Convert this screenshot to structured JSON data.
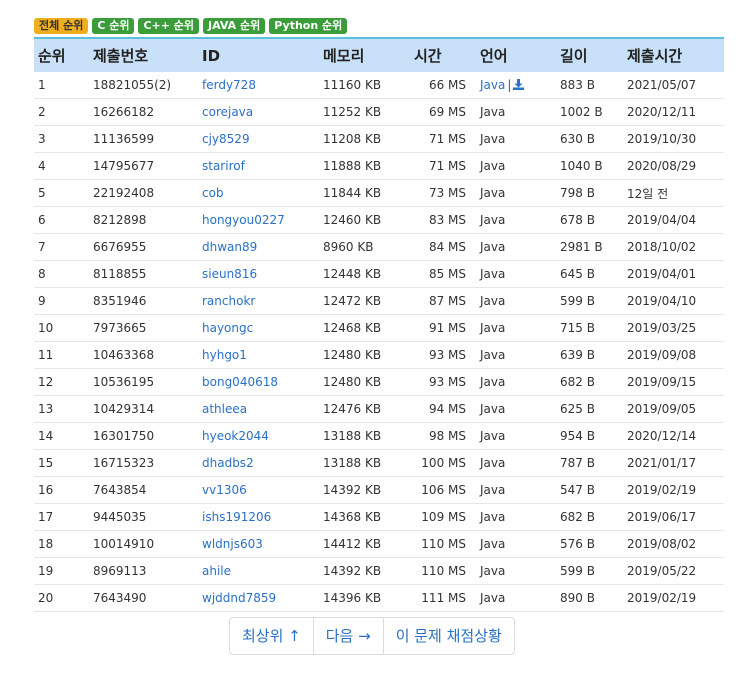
{
  "tabs": [
    {
      "label": "전체 순위",
      "active": true
    },
    {
      "label": "C 순위",
      "active": false
    },
    {
      "label": "C++ 순위",
      "active": false
    },
    {
      "label": "JAVA 순위",
      "active": false
    },
    {
      "label": "Python 순위",
      "active": false
    }
  ],
  "table": {
    "headers": [
      "순위",
      "제출번호",
      "ID",
      "메모리",
      "시간",
      "언어",
      "길이",
      "제출시간"
    ],
    "rows": [
      {
        "rank": "1",
        "submission": "18821055(2)",
        "id": "ferdy728",
        "memory": "11160 KB",
        "time": "66 MS",
        "lang": "Java",
        "length": "883 B",
        "submitted": "2021/05/07"
      },
      {
        "rank": "2",
        "submission": "16266182",
        "id": "corejava",
        "memory": "11252 KB",
        "time": "69 MS",
        "lang": "Java",
        "length": "1002 B",
        "submitted": "2020/12/11"
      },
      {
        "rank": "3",
        "submission": "11136599",
        "id": "cjy8529",
        "memory": "11208 KB",
        "time": "71 MS",
        "lang": "Java",
        "length": "630 B",
        "submitted": "2019/10/30"
      },
      {
        "rank": "4",
        "submission": "14795677",
        "id": "starirof",
        "memory": "11888 KB",
        "time": "71 MS",
        "lang": "Java",
        "length": "1040 B",
        "submitted": "2020/08/29"
      },
      {
        "rank": "5",
        "submission": "22192408",
        "id": "cob",
        "memory": "11844 KB",
        "time": "73 MS",
        "lang": "Java",
        "length": "798 B",
        "submitted": "12일 전"
      },
      {
        "rank": "6",
        "submission": "8212898",
        "id": "hongyou0227",
        "memory": "12460 KB",
        "time": "83 MS",
        "lang": "Java",
        "length": "678 B",
        "submitted": "2019/04/04"
      },
      {
        "rank": "7",
        "submission": "6676955",
        "id": "dhwan89",
        "memory": "8960 KB",
        "time": "84 MS",
        "lang": "Java",
        "length": "2981 B",
        "submitted": "2018/10/02"
      },
      {
        "rank": "8",
        "submission": "8118855",
        "id": "sieun816",
        "memory": "12448 KB",
        "time": "85 MS",
        "lang": "Java",
        "length": "645 B",
        "submitted": "2019/04/01"
      },
      {
        "rank": "9",
        "submission": "8351946",
        "id": "ranchokr",
        "memory": "12472 KB",
        "time": "87 MS",
        "lang": "Java",
        "length": "599 B",
        "submitted": "2019/04/10"
      },
      {
        "rank": "10",
        "submission": "7973665",
        "id": "hayongc",
        "memory": "12468 KB",
        "time": "91 MS",
        "lang": "Java",
        "length": "715 B",
        "submitted": "2019/03/25"
      },
      {
        "rank": "11",
        "submission": "10463368",
        "id": "hyhgo1",
        "memory": "12480 KB",
        "time": "93 MS",
        "lang": "Java",
        "length": "639 B",
        "submitted": "2019/09/08"
      },
      {
        "rank": "12",
        "submission": "10536195",
        "id": "bong040618",
        "memory": "12480 KB",
        "time": "93 MS",
        "lang": "Java",
        "length": "682 B",
        "submitted": "2019/09/15"
      },
      {
        "rank": "13",
        "submission": "10429314",
        "id": "athleea",
        "memory": "12476 KB",
        "time": "94 MS",
        "lang": "Java",
        "length": "625 B",
        "submitted": "2019/09/05"
      },
      {
        "rank": "14",
        "submission": "16301750",
        "id": "hyeok2044",
        "memory": "13188 KB",
        "time": "98 MS",
        "lang": "Java",
        "length": "954 B",
        "submitted": "2020/12/14"
      },
      {
        "rank": "15",
        "submission": "16715323",
        "id": "dhadbs2",
        "memory": "13188 KB",
        "time": "100 MS",
        "lang": "Java",
        "length": "787 B",
        "submitted": "2021/01/17"
      },
      {
        "rank": "16",
        "submission": "7643854",
        "id": "vv1306",
        "memory": "14392 KB",
        "time": "106 MS",
        "lang": "Java",
        "length": "547 B",
        "submitted": "2019/02/19"
      },
      {
        "rank": "17",
        "submission": "9445035",
        "id": "ishs191206",
        "memory": "14368 KB",
        "time": "109 MS",
        "lang": "Java",
        "length": "682 B",
        "submitted": "2019/06/17"
      },
      {
        "rank": "18",
        "submission": "10014910",
        "id": "wldnjs603",
        "memory": "14412 KB",
        "time": "110 MS",
        "lang": "Java",
        "length": "576 B",
        "submitted": "2019/08/02"
      },
      {
        "rank": "19",
        "submission": "8969113",
        "id": "ahile",
        "memory": "14392 KB",
        "time": "110 MS",
        "lang": "Java",
        "length": "599 B",
        "submitted": "2019/05/22"
      },
      {
        "rank": "20",
        "submission": "7643490",
        "id": "wjddnd7859",
        "memory": "14396 KB",
        "time": "111 MS",
        "lang": "Java",
        "length": "890 B",
        "submitted": "2019/02/19"
      }
    ],
    "first_row_separator": "|",
    "first_row_icon": "download-icon"
  },
  "pager": {
    "top_label": "최상위 ↑",
    "next_label": "다음 →",
    "status_label": "이 문제 채점상황"
  },
  "colors": {
    "link": "#2a70c9",
    "header_bg": "#c8e1f8",
    "active_tab": "#f0ad1e",
    "tab": "#3a9d3a"
  }
}
